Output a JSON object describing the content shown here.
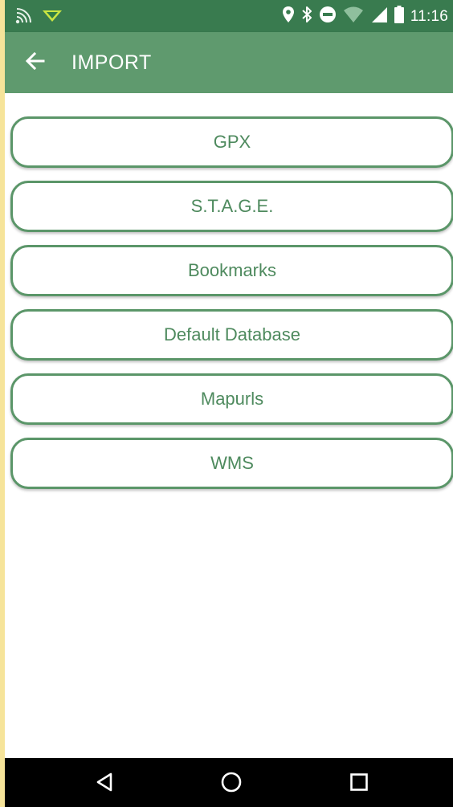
{
  "status_bar": {
    "time": "11:16",
    "icons_left": [
      "cast-wifi-icon",
      "download-notification-icon"
    ],
    "icons_right": [
      "location-icon",
      "bluetooth-icon",
      "do-not-disturb-icon",
      "wifi-icon",
      "signal-icon",
      "battery-icon"
    ]
  },
  "app_bar": {
    "title": "IMPORT",
    "back_icon": "arrow-left-icon",
    "background": "#5f9a6e"
  },
  "import_options": [
    {
      "label": "GPX"
    },
    {
      "label": "S.T.A.G.E."
    },
    {
      "label": "Bookmarks"
    },
    {
      "label": "Default Database"
    },
    {
      "label": "Mapurls"
    },
    {
      "label": "WMS"
    }
  ],
  "nav_bar": {
    "buttons": [
      "back-triangle-icon",
      "home-circle-icon",
      "recents-square-icon"
    ]
  },
  "colors": {
    "status_bar": "#397b4f",
    "accent": "#5b9669",
    "button_text": "#4e8a5e"
  }
}
